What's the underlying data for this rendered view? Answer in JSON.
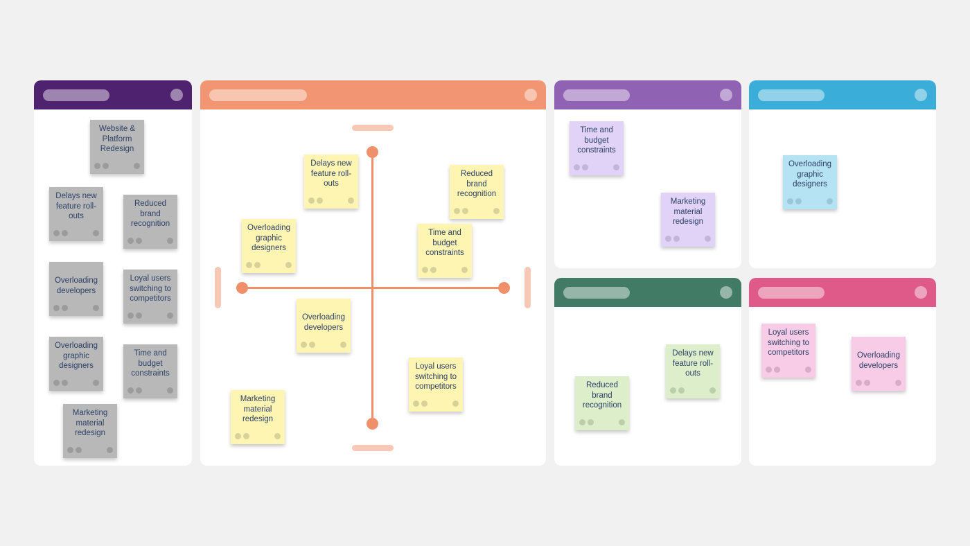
{
  "colors": {
    "background": "#f1f1f1",
    "panel_backlog": "#4e226f",
    "panel_matrix": "#f29572",
    "panel_purple": "#8f62b3",
    "panel_blue": "#3aaed8",
    "panel_green": "#417a65",
    "panel_pink": "#df5a88",
    "axis": "#f0906a",
    "note_text": "#2d4166"
  },
  "panels": {
    "backlog": {
      "header_color": "#4e226f",
      "notes": [
        {
          "text": "Website & Platform Redesign",
          "color": "gray"
        },
        {
          "text": "Delays new feature roll-outs",
          "color": "gray"
        },
        {
          "text": "Reduced brand recognition",
          "color": "gray"
        },
        {
          "text": "Overloading developers",
          "color": "gray"
        },
        {
          "text": "Loyal users switching to competitors",
          "color": "gray"
        },
        {
          "text": "Overloading graphic designers",
          "color": "gray"
        },
        {
          "text": "Time and budget constraints",
          "color": "gray"
        },
        {
          "text": "Marketing material redesign",
          "color": "gray"
        }
      ]
    },
    "matrix": {
      "header_color": "#f29572",
      "notes": [
        {
          "text": "Delays new feature roll-outs",
          "color": "yellow"
        },
        {
          "text": "Reduced brand recognition",
          "color": "yellow"
        },
        {
          "text": "Overloading graphic designers",
          "color": "yellow"
        },
        {
          "text": "Time and budget constraints",
          "color": "yellow"
        },
        {
          "text": "Overloading developers",
          "color": "yellow"
        },
        {
          "text": "Loyal users switching to competitors",
          "color": "yellow"
        },
        {
          "text": "Marketing material redesign",
          "color": "yellow"
        }
      ]
    },
    "purple": {
      "header_color": "#8f62b3",
      "notes": [
        {
          "text": "Time and budget constraints",
          "color": "lilac"
        },
        {
          "text": "Marketing material redesign",
          "color": "lilac"
        }
      ]
    },
    "blue": {
      "header_color": "#3aaed8",
      "notes": [
        {
          "text": "Overloading graphic designers",
          "color": "blue"
        }
      ]
    },
    "green": {
      "header_color": "#417a65",
      "notes": [
        {
          "text": "Delays new feature roll-outs",
          "color": "green"
        },
        {
          "text": "Reduced brand recognition",
          "color": "green"
        }
      ]
    },
    "pink": {
      "header_color": "#df5a88",
      "notes": [
        {
          "text": "Loyal users switching to competitors",
          "color": "pink"
        },
        {
          "text": "Overloading developers",
          "color": "pink"
        }
      ]
    }
  }
}
